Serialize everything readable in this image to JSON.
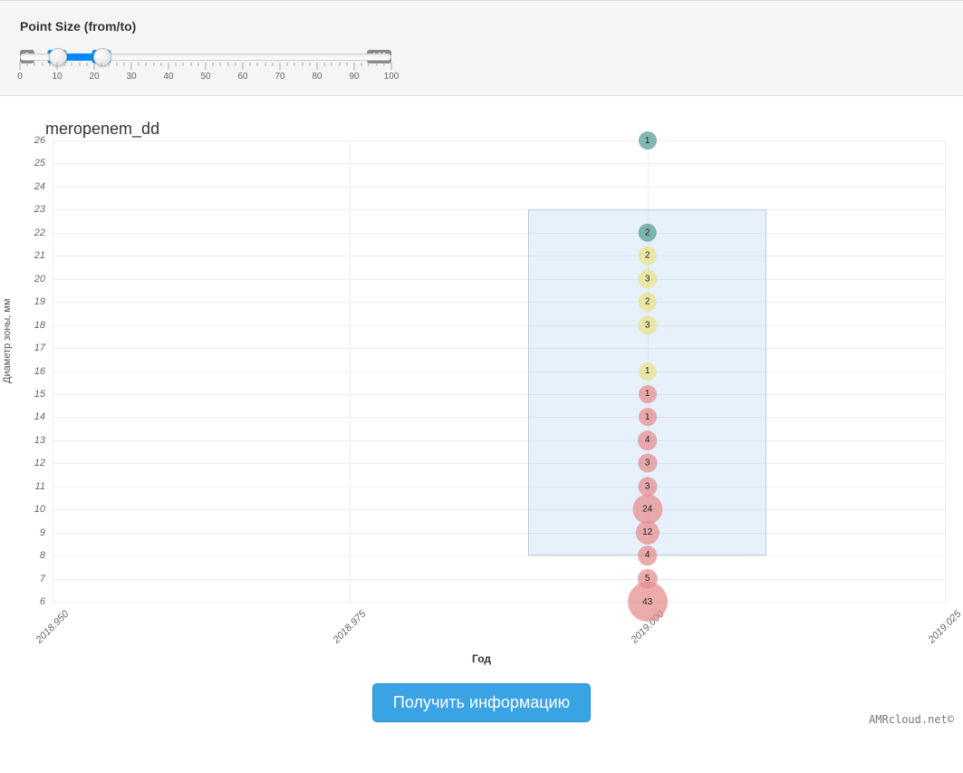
{
  "slider": {
    "label": "Point Size (from/to)",
    "min_label": "0",
    "max_label": "100",
    "from": "10",
    "to": "22",
    "ticks": [
      "0",
      "10",
      "20",
      "30",
      "40",
      "50",
      "60",
      "70",
      "80",
      "90",
      "100"
    ]
  },
  "chart_data": {
    "type": "scatter",
    "title": "meropenem_dd",
    "xlabel": "Год",
    "ylabel": "Диаметр зоны, мм",
    "x_ticks": [
      "2018.950",
      "2018.975",
      "2019.000",
      "2019.025"
    ],
    "y_ticks": [
      6,
      7,
      8,
      9,
      10,
      11,
      12,
      13,
      14,
      15,
      16,
      17,
      18,
      19,
      20,
      21,
      22,
      23,
      24,
      25,
      26
    ],
    "ylim": [
      6,
      26
    ],
    "points": [
      {
        "x": 2019.0,
        "y": 26,
        "count": 1,
        "group": "S"
      },
      {
        "x": 2019.0,
        "y": 22,
        "count": 2,
        "group": "S"
      },
      {
        "x": 2019.0,
        "y": 21,
        "count": 2,
        "group": "I"
      },
      {
        "x": 2019.0,
        "y": 20,
        "count": 3,
        "group": "I"
      },
      {
        "x": 2019.0,
        "y": 19,
        "count": 2,
        "group": "I"
      },
      {
        "x": 2019.0,
        "y": 18,
        "count": 3,
        "group": "I"
      },
      {
        "x": 2019.0,
        "y": 16,
        "count": 1,
        "group": "I"
      },
      {
        "x": 2019.0,
        "y": 15,
        "count": 1,
        "group": "R"
      },
      {
        "x": 2019.0,
        "y": 14,
        "count": 1,
        "group": "R"
      },
      {
        "x": 2019.0,
        "y": 13,
        "count": 4,
        "group": "R"
      },
      {
        "x": 2019.0,
        "y": 12,
        "count": 3,
        "group": "R"
      },
      {
        "x": 2019.0,
        "y": 11,
        "count": 3,
        "group": "R"
      },
      {
        "x": 2019.0,
        "y": 10,
        "count": 24,
        "group": "R"
      },
      {
        "x": 2019.0,
        "y": 9,
        "count": 12,
        "group": "R"
      },
      {
        "x": 2019.0,
        "y": 8,
        "count": 4,
        "group": "R"
      },
      {
        "x": 2019.0,
        "y": 7,
        "count": 5,
        "group": "R"
      },
      {
        "x": 2019.0,
        "y": 6,
        "count": 43,
        "group": "R"
      }
    ],
    "selection": {
      "x0": 2018.99,
      "x1": 2019.01,
      "y0": 8,
      "y1": 23
    }
  },
  "button": {
    "get_info": "Получить информацию"
  },
  "footer": {
    "credit": "AMRcloud.net©"
  },
  "colors": {
    "S": "#58a096",
    "I": "#ebe18c",
    "R": "#e68c8c",
    "accent": "#0089ff",
    "button": "#3aa3e3"
  }
}
